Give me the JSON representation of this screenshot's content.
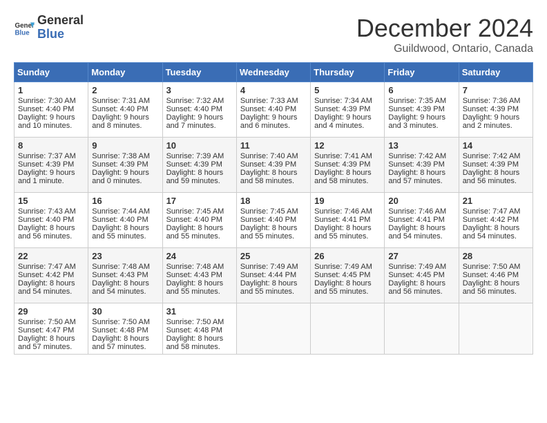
{
  "logo": {
    "line1": "General",
    "line2": "Blue"
  },
  "title": "December 2024",
  "location": "Guildwood, Ontario, Canada",
  "headers": [
    "Sunday",
    "Monday",
    "Tuesday",
    "Wednesday",
    "Thursday",
    "Friday",
    "Saturday"
  ],
  "weeks": [
    [
      {
        "day": "1",
        "sunrise": "7:30 AM",
        "sunset": "4:40 PM",
        "daylight": "9 hours and 10 minutes."
      },
      {
        "day": "2",
        "sunrise": "7:31 AM",
        "sunset": "4:40 PM",
        "daylight": "9 hours and 8 minutes."
      },
      {
        "day": "3",
        "sunrise": "7:32 AM",
        "sunset": "4:40 PM",
        "daylight": "9 hours and 7 minutes."
      },
      {
        "day": "4",
        "sunrise": "7:33 AM",
        "sunset": "4:40 PM",
        "daylight": "9 hours and 6 minutes."
      },
      {
        "day": "5",
        "sunrise": "7:34 AM",
        "sunset": "4:39 PM",
        "daylight": "9 hours and 4 minutes."
      },
      {
        "day": "6",
        "sunrise": "7:35 AM",
        "sunset": "4:39 PM",
        "daylight": "9 hours and 3 minutes."
      },
      {
        "day": "7",
        "sunrise": "7:36 AM",
        "sunset": "4:39 PM",
        "daylight": "9 hours and 2 minutes."
      }
    ],
    [
      {
        "day": "8",
        "sunrise": "7:37 AM",
        "sunset": "4:39 PM",
        "daylight": "9 hours and 1 minute."
      },
      {
        "day": "9",
        "sunrise": "7:38 AM",
        "sunset": "4:39 PM",
        "daylight": "9 hours and 0 minutes."
      },
      {
        "day": "10",
        "sunrise": "7:39 AM",
        "sunset": "4:39 PM",
        "daylight": "8 hours and 59 minutes."
      },
      {
        "day": "11",
        "sunrise": "7:40 AM",
        "sunset": "4:39 PM",
        "daylight": "8 hours and 58 minutes."
      },
      {
        "day": "12",
        "sunrise": "7:41 AM",
        "sunset": "4:39 PM",
        "daylight": "8 hours and 58 minutes."
      },
      {
        "day": "13",
        "sunrise": "7:42 AM",
        "sunset": "4:39 PM",
        "daylight": "8 hours and 57 minutes."
      },
      {
        "day": "14",
        "sunrise": "7:42 AM",
        "sunset": "4:39 PM",
        "daylight": "8 hours and 56 minutes."
      }
    ],
    [
      {
        "day": "15",
        "sunrise": "7:43 AM",
        "sunset": "4:40 PM",
        "daylight": "8 hours and 56 minutes."
      },
      {
        "day": "16",
        "sunrise": "7:44 AM",
        "sunset": "4:40 PM",
        "daylight": "8 hours and 55 minutes."
      },
      {
        "day": "17",
        "sunrise": "7:45 AM",
        "sunset": "4:40 PM",
        "daylight": "8 hours and 55 minutes."
      },
      {
        "day": "18",
        "sunrise": "7:45 AM",
        "sunset": "4:40 PM",
        "daylight": "8 hours and 55 minutes."
      },
      {
        "day": "19",
        "sunrise": "7:46 AM",
        "sunset": "4:41 PM",
        "daylight": "8 hours and 55 minutes."
      },
      {
        "day": "20",
        "sunrise": "7:46 AM",
        "sunset": "4:41 PM",
        "daylight": "8 hours and 54 minutes."
      },
      {
        "day": "21",
        "sunrise": "7:47 AM",
        "sunset": "4:42 PM",
        "daylight": "8 hours and 54 minutes."
      }
    ],
    [
      {
        "day": "22",
        "sunrise": "7:47 AM",
        "sunset": "4:42 PM",
        "daylight": "8 hours and 54 minutes."
      },
      {
        "day": "23",
        "sunrise": "7:48 AM",
        "sunset": "4:43 PM",
        "daylight": "8 hours and 54 minutes."
      },
      {
        "day": "24",
        "sunrise": "7:48 AM",
        "sunset": "4:43 PM",
        "daylight": "8 hours and 55 minutes."
      },
      {
        "day": "25",
        "sunrise": "7:49 AM",
        "sunset": "4:44 PM",
        "daylight": "8 hours and 55 minutes."
      },
      {
        "day": "26",
        "sunrise": "7:49 AM",
        "sunset": "4:45 PM",
        "daylight": "8 hours and 55 minutes."
      },
      {
        "day": "27",
        "sunrise": "7:49 AM",
        "sunset": "4:45 PM",
        "daylight": "8 hours and 56 minutes."
      },
      {
        "day": "28",
        "sunrise": "7:50 AM",
        "sunset": "4:46 PM",
        "daylight": "8 hours and 56 minutes."
      }
    ],
    [
      {
        "day": "29",
        "sunrise": "7:50 AM",
        "sunset": "4:47 PM",
        "daylight": "8 hours and 57 minutes."
      },
      {
        "day": "30",
        "sunrise": "7:50 AM",
        "sunset": "4:48 PM",
        "daylight": "8 hours and 57 minutes."
      },
      {
        "day": "31",
        "sunrise": "7:50 AM",
        "sunset": "4:48 PM",
        "daylight": "8 hours and 58 minutes."
      },
      null,
      null,
      null,
      null
    ]
  ],
  "labels": {
    "sunrise": "Sunrise: ",
    "sunset": "Sunset: ",
    "daylight": "Daylight: "
  }
}
